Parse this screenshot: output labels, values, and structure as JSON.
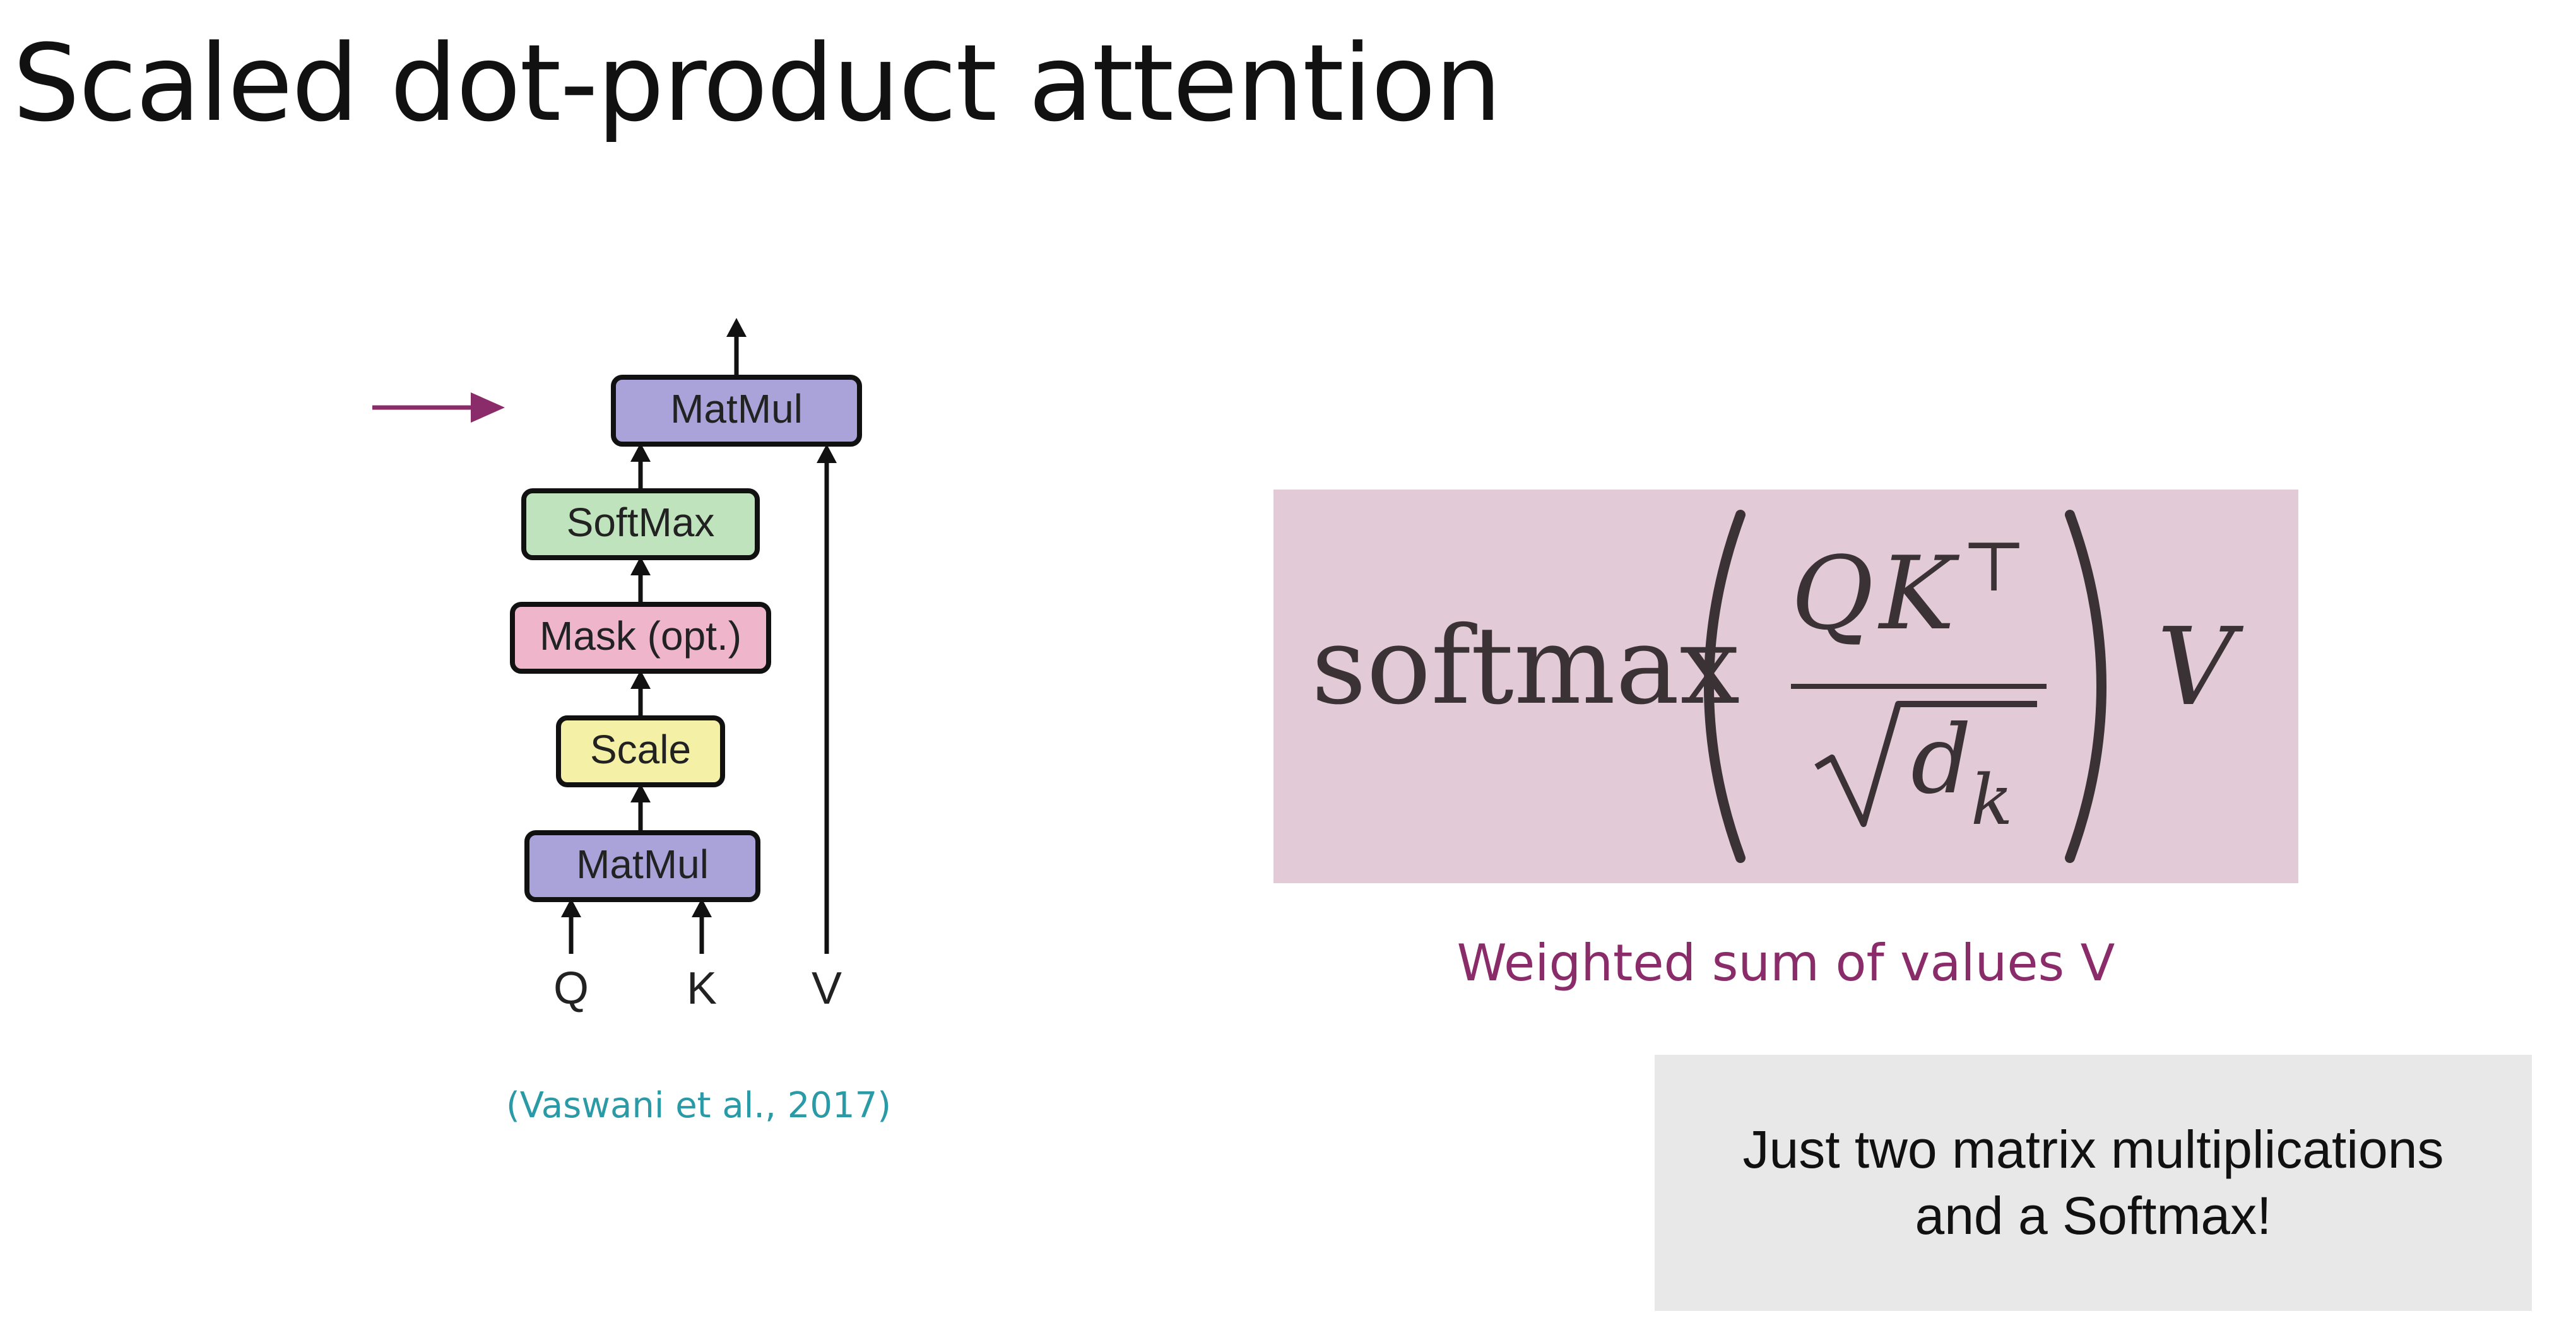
{
  "title": "Scaled dot-product attention",
  "diagram": {
    "blocks": {
      "matmul_top": "MatMul",
      "softmax": "SoftMax",
      "mask": "Mask (opt.)",
      "scale": "Scale",
      "matmul_bottom": "MatMul"
    },
    "inputs": {
      "q": "Q",
      "k": "K",
      "v": "V"
    },
    "citation": "(Vaswani et al., 2017)",
    "colors": {
      "matmul": "#a9a3d9",
      "softmax": "#bfe3bd",
      "mask": "#efb6cb",
      "scale": "#f4f0a6",
      "pointer_arrow": "#8a2c6a"
    }
  },
  "formula": {
    "func": "softmax",
    "numerator_q": "Q",
    "numerator_k": "K",
    "transpose": "⊤",
    "root_d": "d",
    "root_sub": "k",
    "value": "V",
    "box_color": "#e3cad7"
  },
  "formula_caption": "Weighted sum of values V",
  "note": {
    "line1": "Just two matrix multiplications",
    "line2": "and a Softmax!"
  }
}
